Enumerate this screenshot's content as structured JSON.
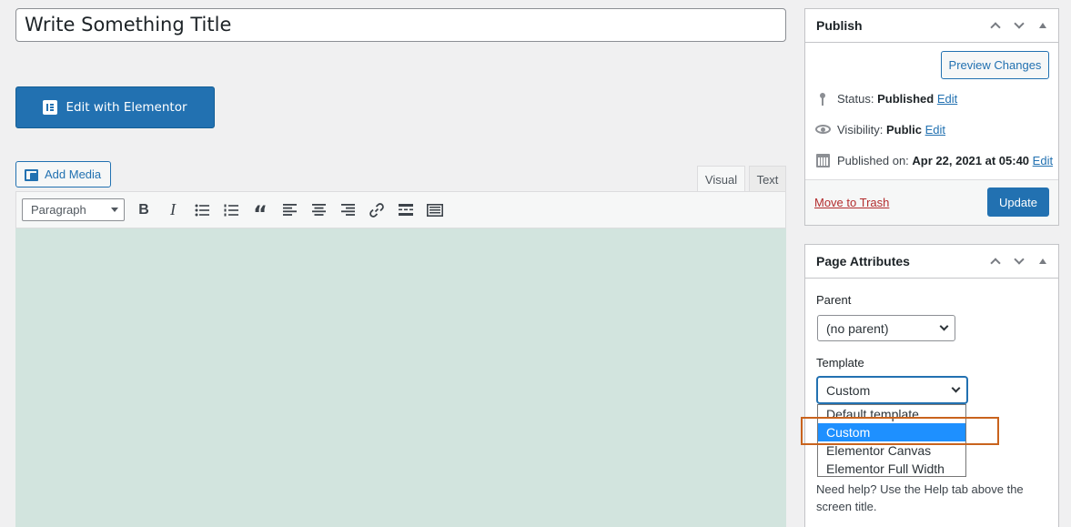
{
  "title": {
    "value": "Write Something Title"
  },
  "elementor_button": {
    "label": "Edit with Elementor"
  },
  "editor": {
    "add_media_label": "Add Media",
    "tabs": [
      {
        "label": "Visual",
        "active": true
      },
      {
        "label": "Text",
        "active": false
      }
    ],
    "format_select": "Paragraph",
    "toolbar_buttons": [
      "bold",
      "italic",
      "bulleted-list",
      "numbered-list",
      "blockquote",
      "align-left",
      "align-center",
      "align-right",
      "insert-link",
      "read-more",
      "toolbar-toggle"
    ],
    "content_bg_color": "#d2e4de"
  },
  "publish": {
    "title": "Publish",
    "preview_label": "Preview Changes",
    "status_label": "Status:",
    "status_value": "Published",
    "visibility_label": "Visibility:",
    "visibility_value": "Public",
    "published_label": "Published on:",
    "published_value": "Apr 22, 2021 at 05:40",
    "edit_label": "Edit",
    "trash_label": "Move to Trash",
    "update_label": "Update"
  },
  "page_attributes": {
    "title": "Page Attributes",
    "parent_label": "Parent",
    "parent_value": "(no parent)",
    "template_label": "Template",
    "template_value": "Custom",
    "template_options": [
      "Default template",
      "Custom",
      "Elementor Canvas",
      "Elementor Full Width"
    ],
    "selected_option": "Custom",
    "help_text": "Need help? Use the Help tab above the screen title."
  },
  "colors": {
    "accent": "#2271b1",
    "highlight": "#c9631d",
    "trash": "#b32d2e",
    "selected_option": "#1e90ff"
  }
}
